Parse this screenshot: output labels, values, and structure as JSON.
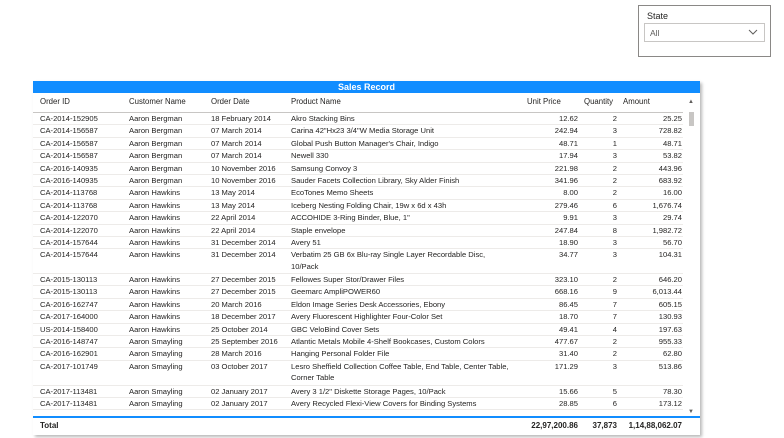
{
  "slicer": {
    "title": "State",
    "value": "All",
    "chevron_icon": "chevron-down-icon"
  },
  "table": {
    "title": "Sales Record",
    "title_bar_color": "#118dff",
    "headers": [
      "Order ID",
      "Customer Name",
      "Order Date",
      "Product Name",
      "Unit Price",
      "Quantity",
      "Amount"
    ],
    "rows": [
      {
        "order_id": "CA-2014-152905",
        "customer": "Aaron Bergman",
        "date": "18 February 2014",
        "product": "Akro Stacking Bins",
        "unit_price": "12.62",
        "qty": "2",
        "amount": "25.25"
      },
      {
        "order_id": "CA-2014-156587",
        "customer": "Aaron Bergman",
        "date": "07 March 2014",
        "product": "Carina 42\"Hx23 3/4\"W Media Storage Unit",
        "unit_price": "242.94",
        "qty": "3",
        "amount": "728.82"
      },
      {
        "order_id": "CA-2014-156587",
        "customer": "Aaron Bergman",
        "date": "07 March 2014",
        "product": "Global Push Button Manager's Chair, Indigo",
        "unit_price": "48.71",
        "qty": "1",
        "amount": "48.71"
      },
      {
        "order_id": "CA-2014-156587",
        "customer": "Aaron Bergman",
        "date": "07 March 2014",
        "product": "Newell 330",
        "unit_price": "17.94",
        "qty": "3",
        "amount": "53.82"
      },
      {
        "order_id": "CA-2016-140935",
        "customer": "Aaron Bergman",
        "date": "10 November 2016",
        "product": "Samsung Convoy 3",
        "unit_price": "221.98",
        "qty": "2",
        "amount": "443.96"
      },
      {
        "order_id": "CA-2016-140935",
        "customer": "Aaron Bergman",
        "date": "10 November 2016",
        "product": "Sauder Facets Collection Library, Sky Alder Finish",
        "unit_price": "341.96",
        "qty": "2",
        "amount": "683.92"
      },
      {
        "order_id": "CA-2014-113768",
        "customer": "Aaron Hawkins",
        "date": "13 May 2014",
        "product": "EcoTones Memo Sheets",
        "unit_price": "8.00",
        "qty": "2",
        "amount": "16.00"
      },
      {
        "order_id": "CA-2014-113768",
        "customer": "Aaron Hawkins",
        "date": "13 May 2014",
        "product": "Iceberg Nesting Folding Chair, 19w x 6d x 43h",
        "unit_price": "279.46",
        "qty": "6",
        "amount": "1,676.74"
      },
      {
        "order_id": "CA-2014-122070",
        "customer": "Aaron Hawkins",
        "date": "22 April 2014",
        "product": "ACCOHIDE 3-Ring Binder, Blue, 1\"",
        "unit_price": "9.91",
        "qty": "3",
        "amount": "29.74"
      },
      {
        "order_id": "CA-2014-122070",
        "customer": "Aaron Hawkins",
        "date": "22 April 2014",
        "product": "Staple envelope",
        "unit_price": "247.84",
        "qty": "8",
        "amount": "1,982.72"
      },
      {
        "order_id": "CA-2014-157644",
        "customer": "Aaron Hawkins",
        "date": "31 December 2014",
        "product": "Avery 51",
        "unit_price": "18.90",
        "qty": "3",
        "amount": "56.70"
      },
      {
        "order_id": "CA-2014-157644",
        "customer": "Aaron Hawkins",
        "date": "31 December 2014",
        "product": "Verbatim 25 GB 6x Blu-ray Single Layer Recordable Disc, 10/Pack",
        "unit_price": "34.77",
        "qty": "3",
        "amount": "104.31",
        "tall": true
      },
      {
        "order_id": "CA-2015-130113",
        "customer": "Aaron Hawkins",
        "date": "27 December 2015",
        "product": "Fellowes Super Stor/Drawer Files",
        "unit_price": "323.10",
        "qty": "2",
        "amount": "646.20"
      },
      {
        "order_id": "CA-2015-130113",
        "customer": "Aaron Hawkins",
        "date": "27 December 2015",
        "product": "Geemarc AmpliPOWER60",
        "unit_price": "668.16",
        "qty": "9",
        "amount": "6,013.44"
      },
      {
        "order_id": "CA-2016-162747",
        "customer": "Aaron Hawkins",
        "date": "20 March 2016",
        "product": "Eldon Image Series Desk Accessories, Ebony",
        "unit_price": "86.45",
        "qty": "7",
        "amount": "605.15"
      },
      {
        "order_id": "CA-2017-164000",
        "customer": "Aaron Hawkins",
        "date": "18 December 2017",
        "product": "Avery Fluorescent Highlighter Four-Color Set",
        "unit_price": "18.70",
        "qty": "7",
        "amount": "130.93"
      },
      {
        "order_id": "US-2014-158400",
        "customer": "Aaron Hawkins",
        "date": "25 October 2014",
        "product": "GBC VeloBind Cover Sets",
        "unit_price": "49.41",
        "qty": "4",
        "amount": "197.63"
      },
      {
        "order_id": "CA-2016-148747",
        "customer": "Aaron Smayling",
        "date": "25 September 2016",
        "product": "Atlantic Metals Mobile 4-Shelf Bookcases, Custom Colors",
        "unit_price": "477.67",
        "qty": "2",
        "amount": "955.33"
      },
      {
        "order_id": "CA-2016-162901",
        "customer": "Aaron Smayling",
        "date": "28 March 2016",
        "product": "Hanging Personal Folder File",
        "unit_price": "31.40",
        "qty": "2",
        "amount": "62.80"
      },
      {
        "order_id": "CA-2017-101749",
        "customer": "Aaron Smayling",
        "date": "03 October 2017",
        "product": "Lesro Sheffield Collection Coffee Table, End Table, Center Table, Corner Table",
        "unit_price": "171.29",
        "qty": "3",
        "amount": "513.86",
        "tall": true
      },
      {
        "order_id": "CA-2017-113481",
        "customer": "Aaron Smayling",
        "date": "02 January 2017",
        "product": "Avery 3 1/2\" Diskette Storage Pages, 10/Pack",
        "unit_price": "15.66",
        "qty": "5",
        "amount": "78.30"
      },
      {
        "order_id": "CA-2017-113481",
        "customer": "Aaron Smayling",
        "date": "02 January 2017",
        "product": "Avery Recycled Flexi-View Covers for Binding Systems",
        "unit_price": "28.85",
        "qty": "6",
        "amount": "173.12"
      }
    ],
    "total": {
      "label": "Total",
      "unit_price": "22,97,200.86",
      "qty": "37,873",
      "amount": "1,14,88,062.07"
    }
  }
}
